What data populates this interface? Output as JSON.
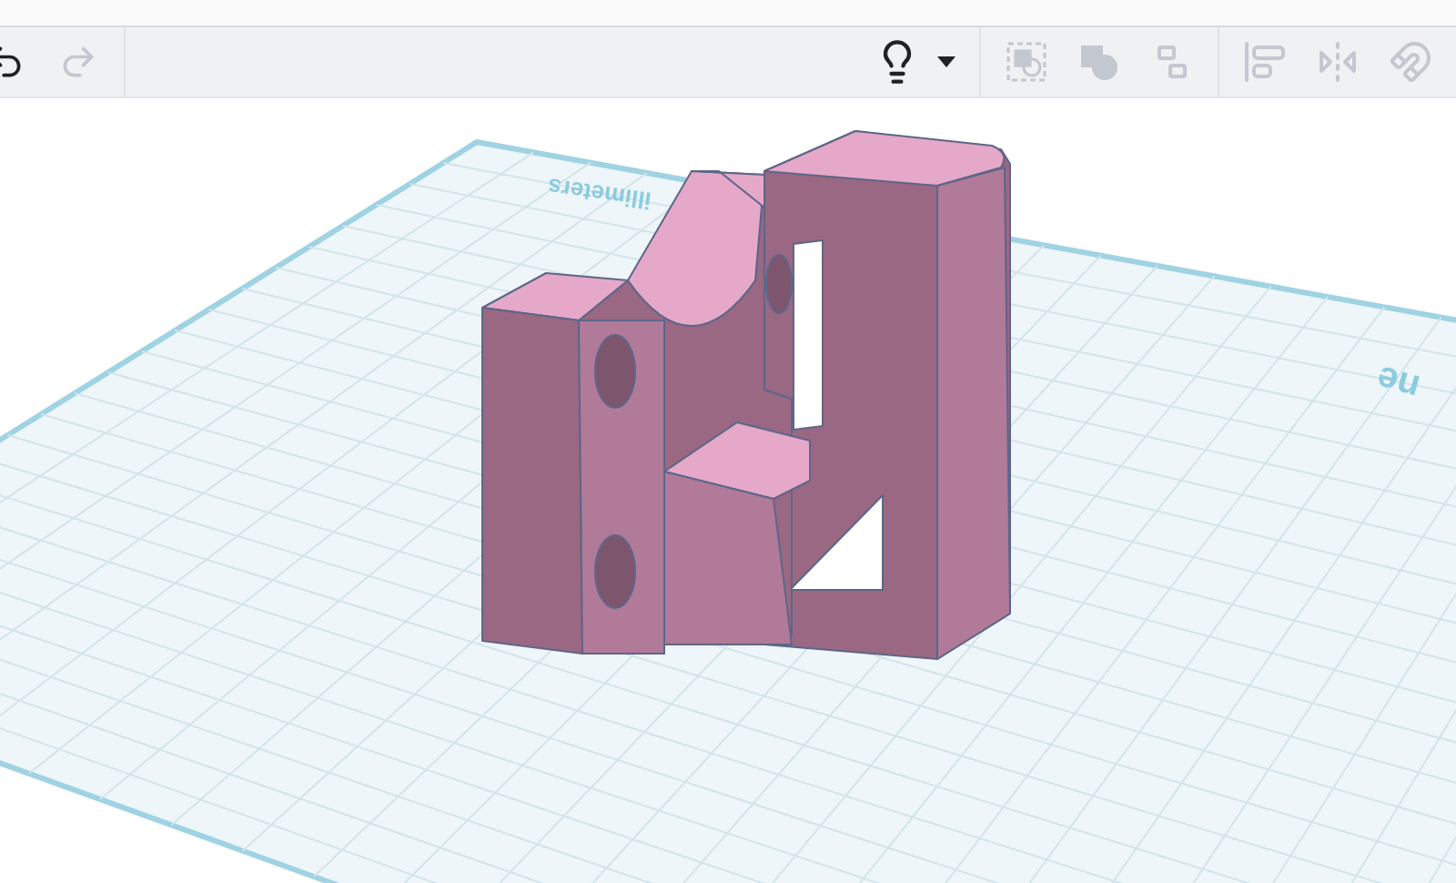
{
  "toolbar": {
    "left": [
      {
        "kind": "undo",
        "disabled": false
      },
      {
        "kind": "redo",
        "disabled": true
      }
    ],
    "right": [
      {
        "kind": "lightbulb",
        "disabled": false
      },
      {
        "kind": "caret",
        "disabled": false
      },
      {
        "kind": "group",
        "disabled": true
      },
      {
        "kind": "solid",
        "disabled": true
      },
      {
        "kind": "ungroup",
        "disabled": true
      },
      {
        "kind": "align",
        "disabled": true
      },
      {
        "kind": "mirror",
        "disabled": true
      },
      {
        "kind": "magnet",
        "disabled": true
      }
    ]
  },
  "workplane": {
    "labels": [
      {
        "kind": "units",
        "text": "illimeters"
      },
      {
        "kind": "title",
        "text": "ne"
      }
    ]
  }
}
